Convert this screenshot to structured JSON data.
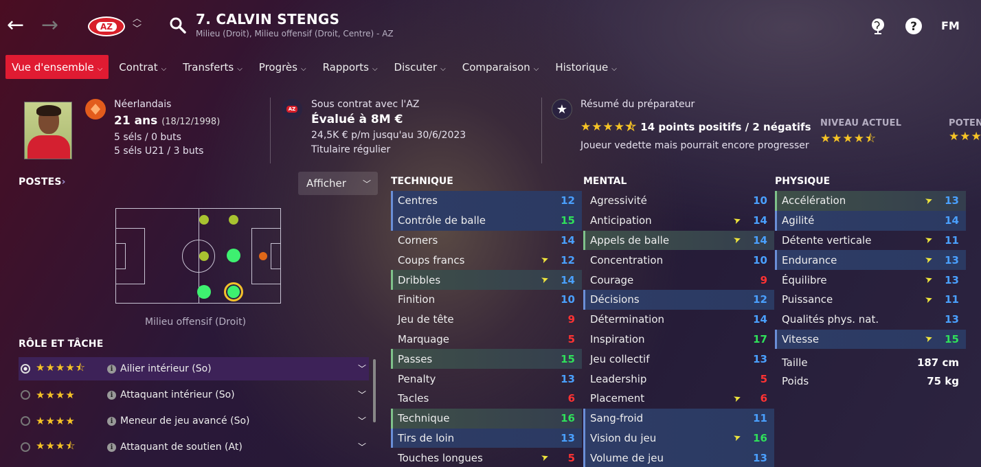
{
  "header": {
    "title": "7. CALVIN STENGS",
    "subtitle": "Milieu (Droit), Milieu offensif (Droit, Centre) - AZ",
    "club_badge": "AZ",
    "brand": "FM"
  },
  "tabs": [
    {
      "label": "Vue d'ensemble"
    },
    {
      "label": "Contrat"
    },
    {
      "label": "Transferts"
    },
    {
      "label": "Progrès"
    },
    {
      "label": "Rapports"
    },
    {
      "label": "Discuter"
    },
    {
      "label": "Comparaison"
    },
    {
      "label": "Historique"
    }
  ],
  "summary": {
    "nationality": "Néerlandais",
    "age": "21 ans",
    "dob": "(18/12/1998)",
    "caps": "5 séls / 0 buts",
    "caps_u21": "5 séls U21 / 3 buts",
    "contract_label": "Sous contrat avec l'AZ",
    "value": "Évalué à 8M €",
    "wage": "24,5K € p/m jusqu'au 30/6/2023",
    "status": "Titulaire régulier",
    "coach_label": "Résumé du préparateur",
    "coach_points": "14 points positifs / 2 négatifs",
    "coach_note": "Joueur vedette mais pourrait encore progresser",
    "coach_stars": 4.5,
    "current_level_label": "NIVEAU ACTUEL",
    "current_level_stars": 4.5,
    "potential_label": "POTEN"
  },
  "positions": {
    "title": "POSTES",
    "filter_label": "Afficher",
    "caption": "Milieu offensif (Droit)"
  },
  "roles": {
    "title": "RÔLE ET TÂCHE",
    "items": [
      {
        "label": "Ailier intérieur (So)",
        "stars": 4.5,
        "selected": true
      },
      {
        "label": "Attaquant intérieur (So)",
        "stars": 4
      },
      {
        "label": "Meneur de jeu avancé (So)",
        "stars": 4
      },
      {
        "label": "Attaquant de soutien (At)",
        "stars": 3.5
      }
    ]
  },
  "attributes": {
    "technique": {
      "title": "TECHNIQUE",
      "rows": [
        {
          "name": "Centres",
          "value": "12",
          "hl": "blue"
        },
        {
          "name": "Contrôle de balle",
          "value": "15",
          "hl": "blue"
        },
        {
          "name": "Corners",
          "value": "14"
        },
        {
          "name": "Coups francs",
          "value": "12",
          "arrow": true
        },
        {
          "name": "Dribbles",
          "value": "14",
          "hl": "green",
          "arrow": true
        },
        {
          "name": "Finition",
          "value": "10"
        },
        {
          "name": "Jeu de tête",
          "value": "9"
        },
        {
          "name": "Marquage",
          "value": "5"
        },
        {
          "name": "Passes",
          "value": "15",
          "hl": "green"
        },
        {
          "name": "Penalty",
          "value": "13"
        },
        {
          "name": "Tacles",
          "value": "6"
        },
        {
          "name": "Technique",
          "value": "16",
          "hl": "green"
        },
        {
          "name": "Tirs de loin",
          "value": "13",
          "hl": "blue"
        },
        {
          "name": "Touches longues",
          "value": "5",
          "arrow": true
        }
      ]
    },
    "mental": {
      "title": "MENTAL",
      "rows": [
        {
          "name": "Agressivité",
          "value": "10"
        },
        {
          "name": "Anticipation",
          "value": "14",
          "arrow": true
        },
        {
          "name": "Appels de balle",
          "value": "14",
          "hl": "green",
          "arrow": true
        },
        {
          "name": "Concentration",
          "value": "10"
        },
        {
          "name": "Courage",
          "value": "9"
        },
        {
          "name": "Décisions",
          "value": "12",
          "hl": "blue"
        },
        {
          "name": "Détermination",
          "value": "14"
        },
        {
          "name": "Inspiration",
          "value": "17"
        },
        {
          "name": "Jeu collectif",
          "value": "13"
        },
        {
          "name": "Leadership",
          "value": "5"
        },
        {
          "name": "Placement",
          "value": "6",
          "arrow": true
        },
        {
          "name": "Sang-froid",
          "value": "11",
          "hl": "blue"
        },
        {
          "name": "Vision du jeu",
          "value": "16",
          "hl": "blue",
          "arrow": true
        },
        {
          "name": "Volume de jeu",
          "value": "13",
          "hl": "blue"
        }
      ]
    },
    "physique": {
      "title": "PHYSIQUE",
      "rows": [
        {
          "name": "Accélération",
          "value": "13",
          "hl": "green",
          "arrow": true
        },
        {
          "name": "Agilité",
          "value": "14",
          "hl": "blue"
        },
        {
          "name": "Détente verticale",
          "value": "11",
          "arrow": true
        },
        {
          "name": "Endurance",
          "value": "13",
          "hl": "blue",
          "arrow": true
        },
        {
          "name": "Équilibre",
          "value": "13",
          "arrow": true
        },
        {
          "name": "Puissance",
          "value": "11",
          "arrow": true
        },
        {
          "name": "Qualités phys. nat.",
          "value": "13"
        },
        {
          "name": "Vitesse",
          "value": "15",
          "hl": "blue",
          "arrow": true
        }
      ],
      "height_label": "Taille",
      "height": "187 cm",
      "weight_label": "Poids",
      "weight": "75 kg"
    }
  },
  "colors": {
    "accent": "#e01b32",
    "attr_blue": "#4aa0ff",
    "attr_green": "#2fe05a",
    "attr_red": "#ff3333",
    "star": "#f6c425"
  }
}
